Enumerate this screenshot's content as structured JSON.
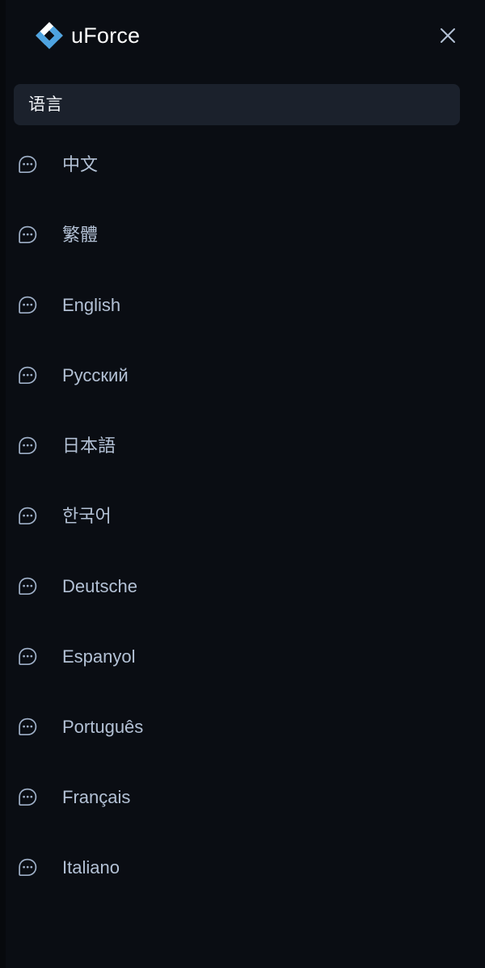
{
  "window": {
    "background_color": "#07090d",
    "panel_color": "#0a0d13"
  },
  "header": {
    "logo_icon": "uforce-diamond-logo-icon",
    "logo_color_primary": "#ffffff",
    "logo_color_accent": "#4ea3e0",
    "brand_name": "uForce",
    "brand_text_color": "#ffffff",
    "close_icon": "close-icon",
    "close_label": "×",
    "close_color": "#b3c1d5"
  },
  "search": {
    "value": "语言",
    "placeholder": "语言",
    "background_color": "#1b212c",
    "text_color": "#f2f4f8"
  },
  "list": {
    "icon_name": "chat-bubble-dots-icon",
    "text_color": "#b3c1d5",
    "items": [
      {
        "label": "中文",
        "icon": "chat-bubble-dots-icon"
      },
      {
        "label": "繁體",
        "icon": "chat-bubble-dots-icon"
      },
      {
        "label": "English",
        "icon": "chat-bubble-dots-icon"
      },
      {
        "label": "Русский",
        "icon": "chat-bubble-dots-icon"
      },
      {
        "label": "日本語",
        "icon": "chat-bubble-dots-icon"
      },
      {
        "label": "한국어",
        "icon": "chat-bubble-dots-icon"
      },
      {
        "label": "Deutsche",
        "icon": "chat-bubble-dots-icon"
      },
      {
        "label": "Espanyol",
        "icon": "chat-bubble-dots-icon"
      },
      {
        "label": "Português",
        "icon": "chat-bubble-dots-icon"
      },
      {
        "label": "Français",
        "icon": "chat-bubble-dots-icon"
      },
      {
        "label": "Italiano",
        "icon": "chat-bubble-dots-icon"
      }
    ]
  }
}
